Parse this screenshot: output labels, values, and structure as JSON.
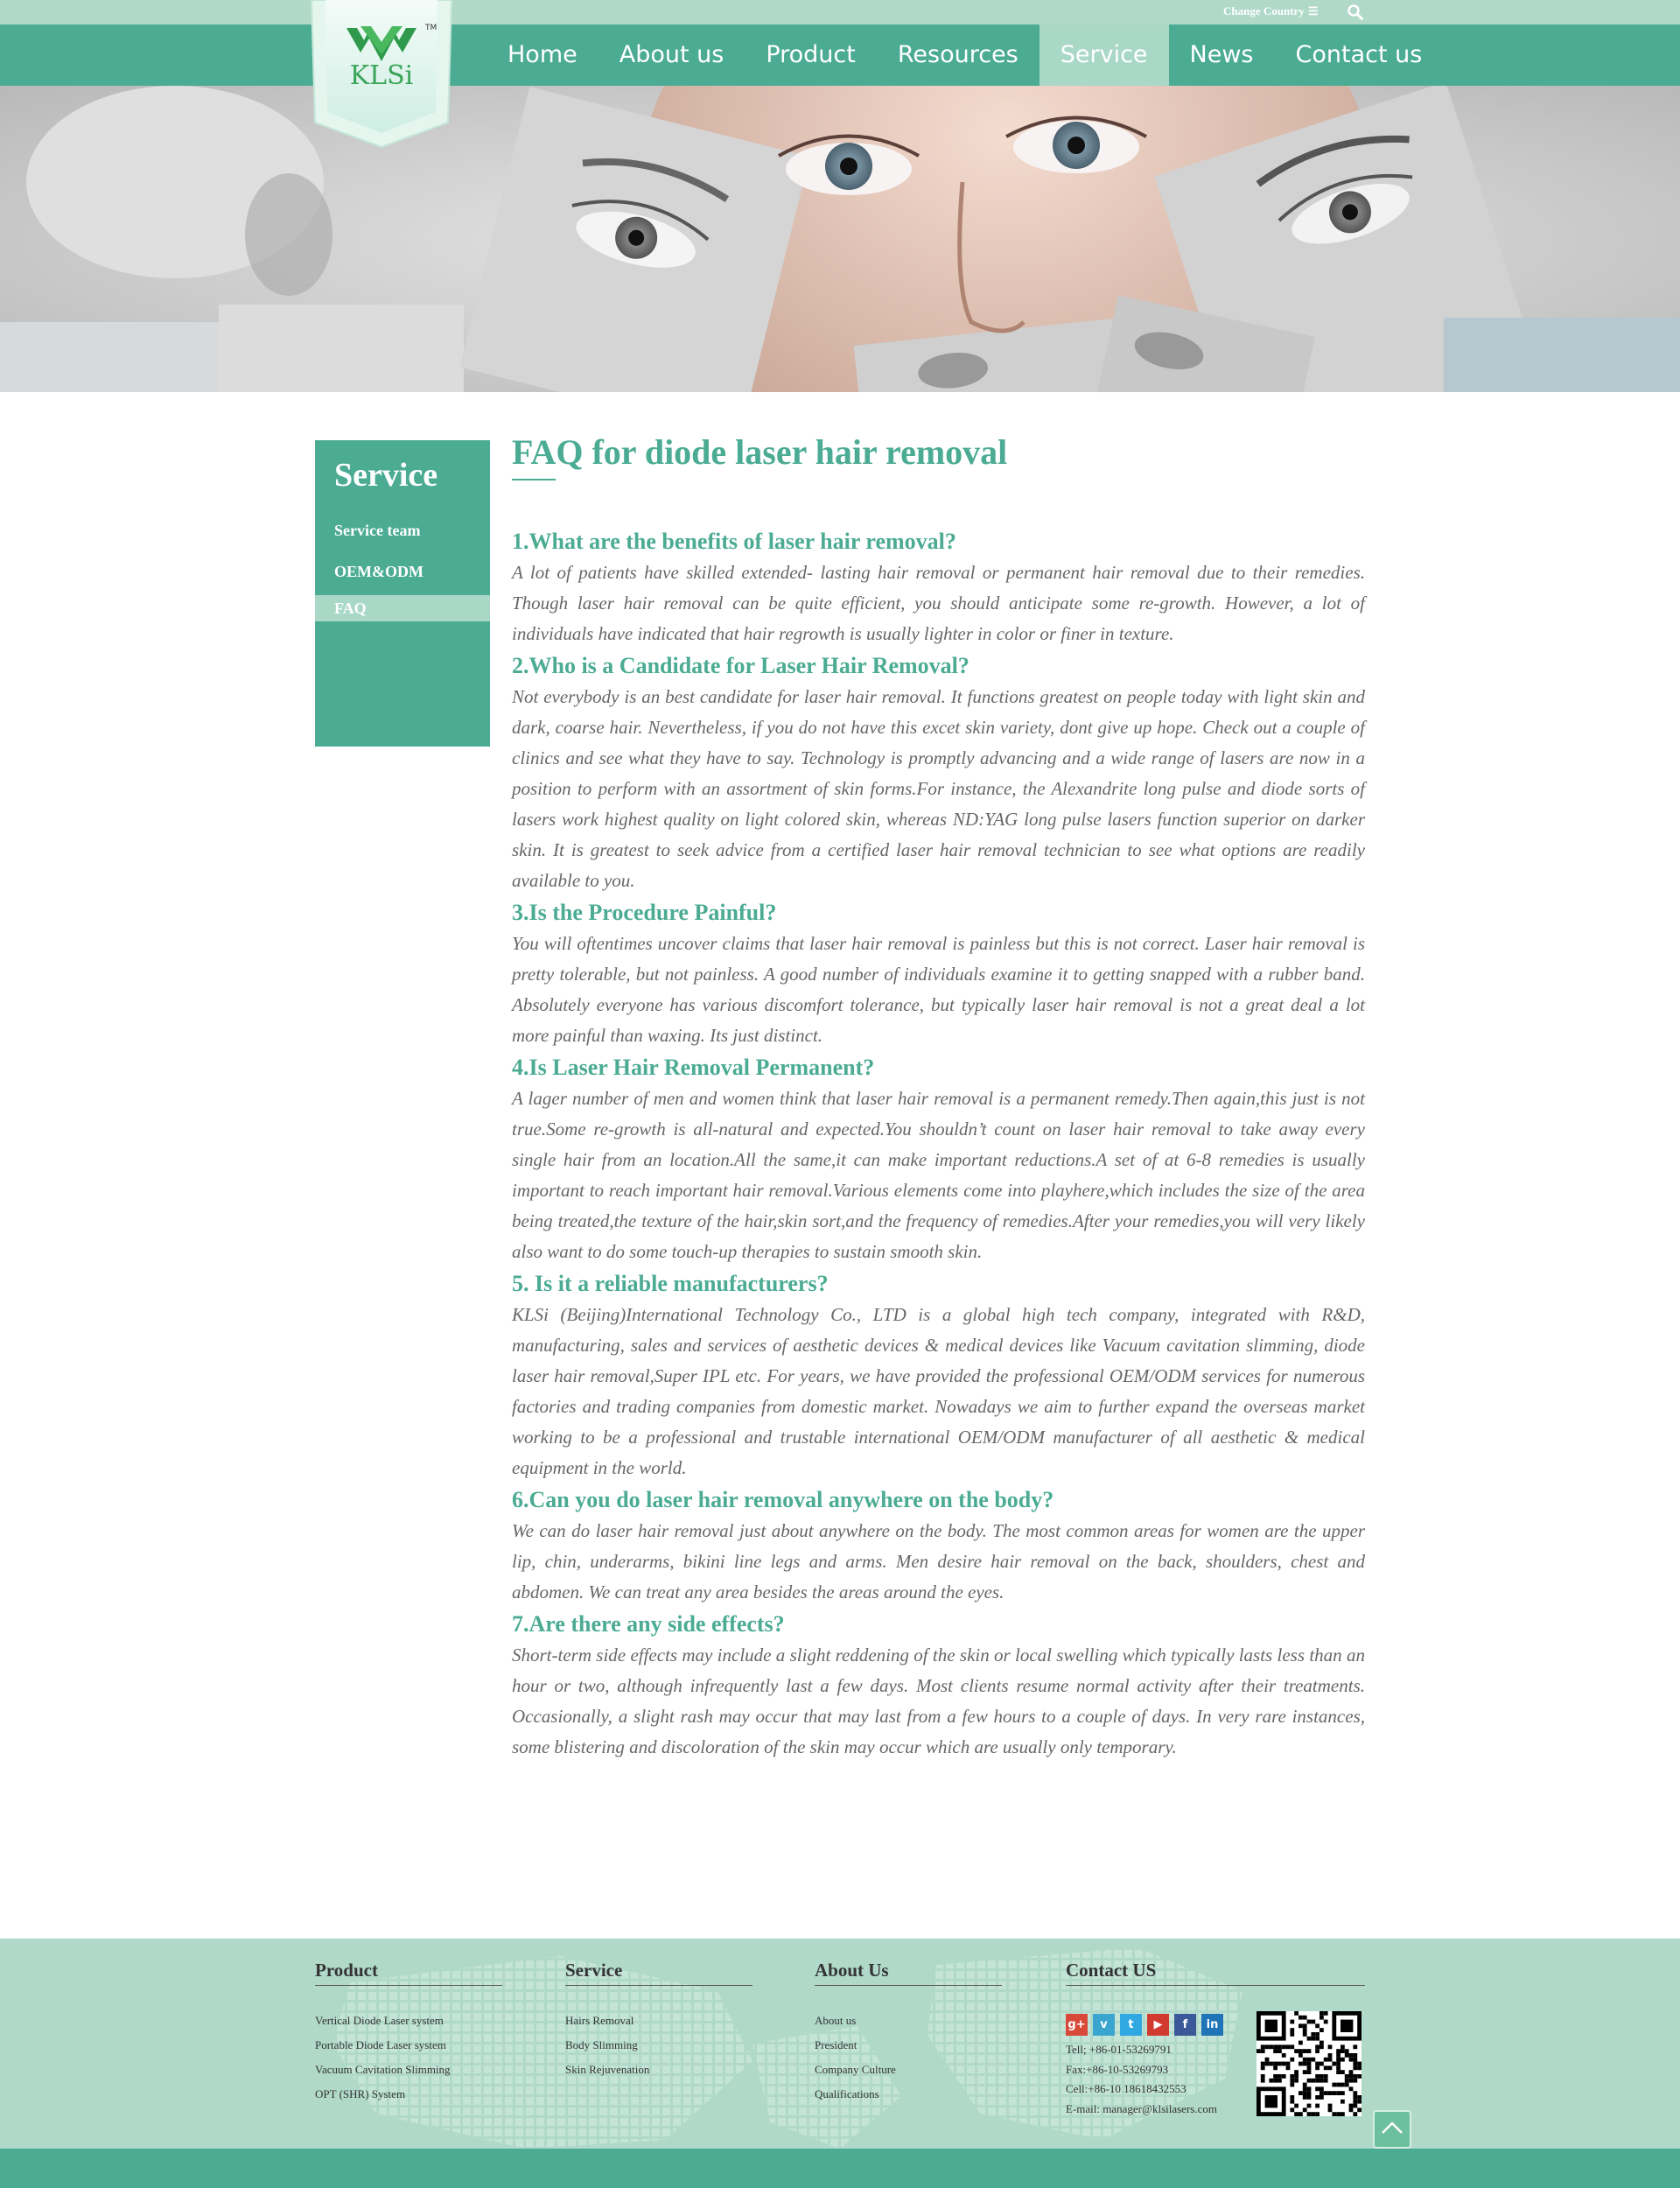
{
  "topbar": {
    "change_country": "Change Country",
    "change_country_icon": "☰"
  },
  "brand": {
    "logo_text": "KLSi",
    "tm": "TM"
  },
  "nav": {
    "items": [
      "Home",
      "About us",
      "Product",
      "Resources",
      "Service",
      "News",
      "Contact us"
    ],
    "active": "Service"
  },
  "sidebar": {
    "title": "Service",
    "items": [
      "Service team",
      "OEM&ODM",
      "FAQ"
    ],
    "active": "FAQ"
  },
  "article": {
    "title": "FAQ for diode laser hair removal",
    "faqs": [
      {
        "q": "1.What are the benefits of laser hair removal?",
        "a": "A lot of patients have skilled extended- lasting hair removal or permanent hair removal due to their remedies. Though laser hair removal can be quite efficient, you should anticipate some re-growth. However, a lot of individuals have indicated that hair regrowth is usually lighter in color or finer in texture."
      },
      {
        "q": "2.Who is a Candidate for Laser Hair Removal?",
        "a": "Not everybody is an best candidate for laser hair removal. It functions greatest on people today with light skin and dark, coarse hair. Nevertheless, if you do not have this excet skin variety, dont give up hope. Check out a couple of clinics and see what they have to say. Technology is promptly advancing and a wide range of lasers are now in a position to perform with an assortment of skin forms.For instance, the Alexandrite long pulse and diode sorts of lasers work highest quality on light colored skin, whereas ND:YAG long pulse lasers function superior on darker skin. It is greatest to seek advice from a certified laser hair removal technician to see what options are readily available to you."
      },
      {
        "q": "3.Is the Procedure Painful?",
        "a": "You will oftentimes uncover claims that laser hair removal is painless but this is not correct. Laser hair removal is pretty tolerable, but not painless. A good number of individuals examine it to getting snapped with a rubber band. Absolutely everyone has various discomfort tolerance, but typically laser hair removal is not a great deal a lot more painful than waxing. Its just distinct."
      },
      {
        "q": "4.Is Laser Hair Removal Permanent?",
        "a": "A lager number of men and women think that laser hair removal is a permanent remedy.Then again,this just is not true.Some re-growth is all-natural and expected.You shouldn’t count on laser hair removal to take away every single hair from an location.All the same,it can make important reductions.A set of at 6-8 remedies is usually important to reach important hair removal.Various elements come into playhere,which includes the size of the area being treated,the texture of the hair,skin sort,and the frequency of remedies.After your remedies,you will very likely also want to do some touch-up therapies to sustain smooth skin."
      },
      {
        "q": "5. Is it a reliable manufacturers?",
        "a": "KLSi (Beijing)International Technology Co., LTD is a global high tech company, integrated with R&D, manufacturing, sales and services of aesthetic devices & medical devices like Vacuum cavitation slimming, diode laser hair removal,Super IPL etc. For years, we have provided  the professional OEM/ODM services for numerous factories and trading companies from domestic market. Nowadays we aim to further expand the overseas market working to be a professional and trustable international OEM/ODM manufacturer of all aesthetic & medical equipment in the world."
      },
      {
        "q": "6.Can you do laser hair removal anywhere on the body?",
        "a": "We can do laser hair removal just about anywhere on the body. The most common areas for women are the upper lip, chin, underarms, bikini line legs and arms. Men desire hair removal on the back, shoulders, chest and abdomen. We can treat any area besides the areas around the eyes."
      },
      {
        "q": "7.Are there any side effects?",
        "a": "Short-term side effects may include a slight reddening of the skin or local swelling which typically lasts less than an hour or two, although infrequently last a few days. Most clients resume normal activity after their treatments. Occasionally, a slight rash may occur that may last from a few hours to a couple of days. In very rare instances, some blistering and discoloration of the skin may occur which are usually only temporary."
      }
    ]
  },
  "footer": {
    "product": {
      "heading": "Product",
      "links": [
        "Vertical Diode Laser system",
        "Portable Diode Laser system",
        "Vacuum Cavitation Slimming",
        "OPT (SHR) System"
      ]
    },
    "service": {
      "heading": "Service",
      "links": [
        "Hairs Removal",
        "Body Slimming",
        "Skin Rejuvenation"
      ]
    },
    "about": {
      "heading": "About Us",
      "links": [
        "About us",
        "President",
        "Company Culture",
        "Qualifications"
      ]
    },
    "contact": {
      "heading": "Contact US",
      "social": [
        {
          "icon": "google-plus-icon",
          "glyph": "g+",
          "color": "#d9493a"
        },
        {
          "icon": "vimeo-icon",
          "glyph": "v",
          "color": "#3aa6d0"
        },
        {
          "icon": "twitter-icon",
          "glyph": "t",
          "color": "#2fa7e0"
        },
        {
          "icon": "youtube-icon",
          "glyph": "▶",
          "color": "#d13a2f"
        },
        {
          "icon": "facebook-icon",
          "glyph": "f",
          "color": "#3b5998"
        },
        {
          "icon": "linkedin-icon",
          "glyph": "in",
          "color": "#1f74b7"
        }
      ],
      "lines": [
        "Tell; +86-01-53269791",
        "Fax:+86-10-53269793",
        "Cell:+86-10 18618432553",
        "E-mail: manager@klsilasers.com"
      ]
    }
  },
  "colors": {
    "primary": "#4bab93",
    "light": "#b0d9c9",
    "active_tab": "#a9d8c7",
    "body_text": "#666666"
  }
}
